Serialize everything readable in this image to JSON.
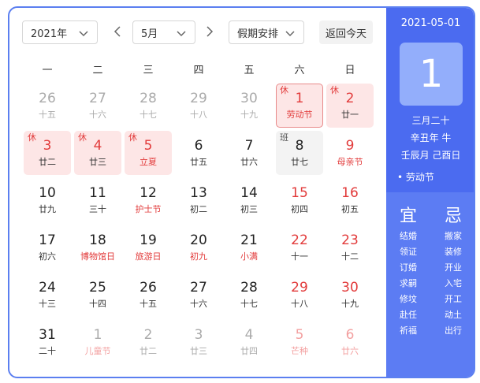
{
  "toolbar": {
    "year": "2021年",
    "month": "5月",
    "holiday": "假期安排",
    "today_label": "返回今天"
  },
  "weekdays": [
    "一",
    "二",
    "三",
    "四",
    "五",
    "六",
    "日"
  ],
  "weeks": [
    [
      {
        "n": "26",
        "s": "十五",
        "other": true
      },
      {
        "n": "27",
        "s": "十六",
        "other": true
      },
      {
        "n": "28",
        "s": "十七",
        "other": true
      },
      {
        "n": "29",
        "s": "十八",
        "other": true
      },
      {
        "n": "30",
        "s": "十九",
        "other": true
      },
      {
        "n": "1",
        "s": "劳动节",
        "tag": "休",
        "holiday": true,
        "selected": true,
        "red": true,
        "festival": true
      },
      {
        "n": "2",
        "s": "廿一",
        "tag": "休",
        "holiday": true,
        "red": true
      }
    ],
    [
      {
        "n": "3",
        "s": "廿二",
        "tag": "休",
        "holiday": true,
        "red": true
      },
      {
        "n": "4",
        "s": "廿三",
        "tag": "休",
        "holiday": true,
        "red": true
      },
      {
        "n": "5",
        "s": "立夏",
        "tag": "休",
        "holiday": true,
        "red": true,
        "festival": true
      },
      {
        "n": "6",
        "s": "廿五"
      },
      {
        "n": "7",
        "s": "廿六"
      },
      {
        "n": "8",
        "s": "廿七",
        "tag": "班",
        "workday": true
      },
      {
        "n": "9",
        "s": "母亲节",
        "weekend": true,
        "festival": true
      }
    ],
    [
      {
        "n": "10",
        "s": "廿九"
      },
      {
        "n": "11",
        "s": "三十"
      },
      {
        "n": "12",
        "s": "护士节",
        "festival": true
      },
      {
        "n": "13",
        "s": "初二"
      },
      {
        "n": "14",
        "s": "初三"
      },
      {
        "n": "15",
        "s": "初四",
        "weekend": true
      },
      {
        "n": "16",
        "s": "初五",
        "weekend": true
      }
    ],
    [
      {
        "n": "17",
        "s": "初六"
      },
      {
        "n": "18",
        "s": "博物馆日",
        "festival": true
      },
      {
        "n": "19",
        "s": "旅游日",
        "festival": true
      },
      {
        "n": "20",
        "s": "初九",
        "festival": true
      },
      {
        "n": "21",
        "s": "小满",
        "festival": true
      },
      {
        "n": "22",
        "s": "十一",
        "weekend": true
      },
      {
        "n": "23",
        "s": "十二",
        "weekend": true
      }
    ],
    [
      {
        "n": "24",
        "s": "十三"
      },
      {
        "n": "25",
        "s": "十四"
      },
      {
        "n": "26",
        "s": "十五"
      },
      {
        "n": "27",
        "s": "十六"
      },
      {
        "n": "28",
        "s": "十七"
      },
      {
        "n": "29",
        "s": "十八",
        "weekend": true
      },
      {
        "n": "30",
        "s": "十九",
        "weekend": true
      }
    ],
    [
      {
        "n": "31",
        "s": "二十"
      },
      {
        "n": "1",
        "s": "儿童节",
        "other": true,
        "festival": true
      },
      {
        "n": "2",
        "s": "廿二",
        "other": true
      },
      {
        "n": "3",
        "s": "廿三",
        "other": true
      },
      {
        "n": "4",
        "s": "廿四",
        "other": true
      },
      {
        "n": "5",
        "s": "芒种",
        "other": true,
        "weekend": true,
        "festival": true
      },
      {
        "n": "6",
        "s": "廿六",
        "other": true,
        "weekend": true
      }
    ]
  ],
  "side": {
    "date": "2021-05-01",
    "day": "1",
    "lunar1": "三月二十",
    "lunar2": "辛丑年 牛",
    "lunar3": "壬辰月 己酉日",
    "festival": "• 劳动节",
    "yi_title": "宜",
    "ji_title": "忌",
    "yi": [
      "结婚",
      "领证",
      "订婚",
      "求嗣",
      "修坟",
      "赴任",
      "祈福"
    ],
    "ji": [
      "搬家",
      "装修",
      "开业",
      "入宅",
      "开工",
      "动土",
      "出行"
    ]
  },
  "colors": {
    "accent": "#4b6bf0",
    "holiday_bg": "#fde6e6",
    "red": "#e23b3b"
  }
}
